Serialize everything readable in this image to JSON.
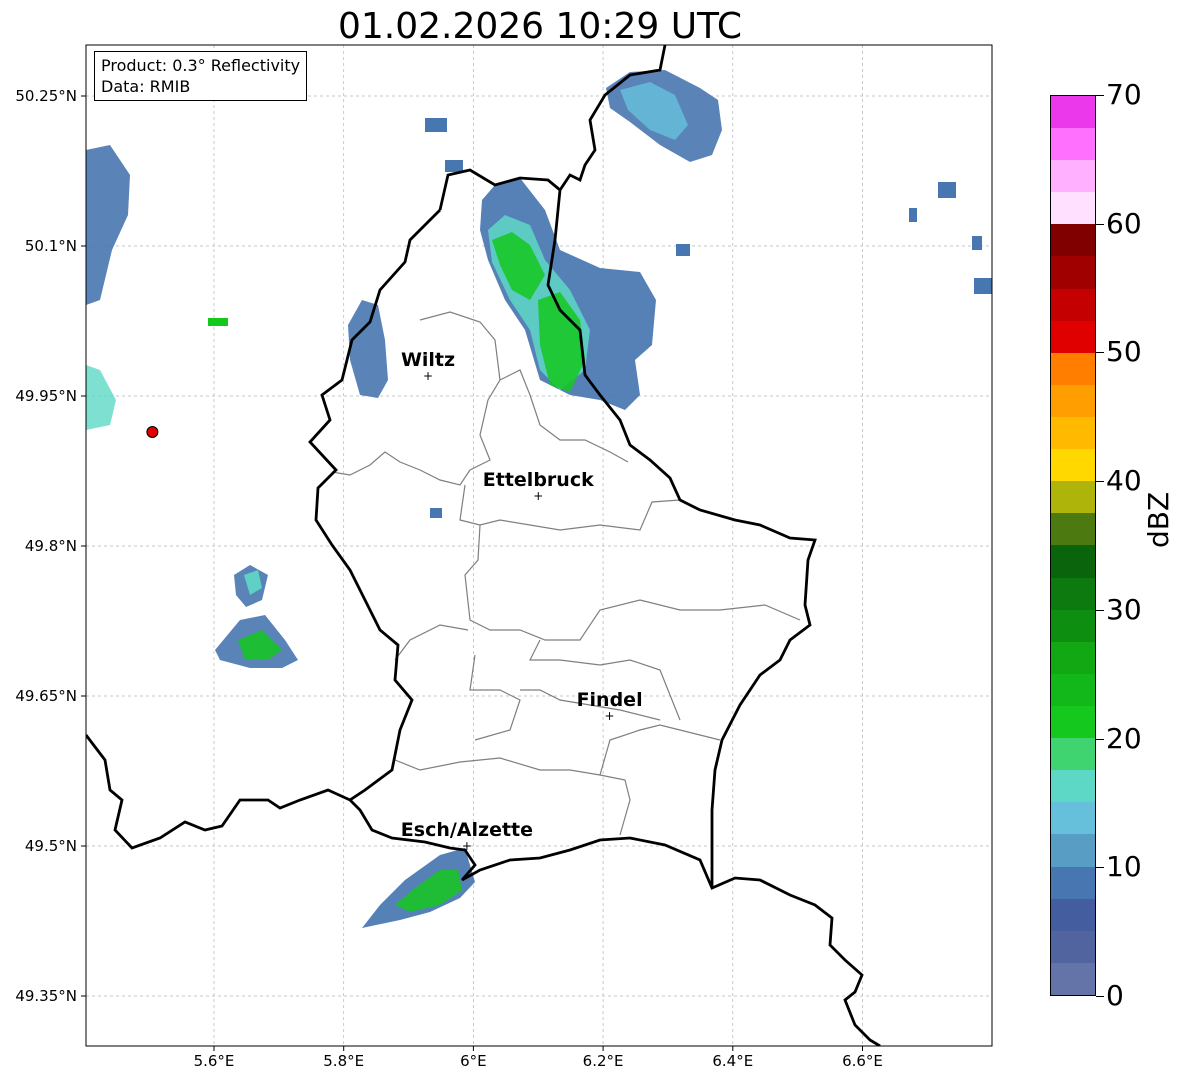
{
  "title": "01.02.2026 10:29 UTC",
  "info": {
    "product": "Product: 0.3° Reflectivity",
    "data": "Data: RMIB"
  },
  "lat_labels": [
    "50.25°N",
    "50.1°N",
    "49.95°N",
    "49.8°N",
    "49.65°N",
    "49.5°N",
    "49.35°N"
  ],
  "lon_labels": [
    "5.6°E",
    "5.8°E",
    "6°E",
    "6.2°E",
    "6.4°E",
    "6.6°E"
  ],
  "cities": [
    {
      "name": "Wiltz",
      "lon": 5.93,
      "lat": 49.97
    },
    {
      "name": "Ettelbruck",
      "lon": 6.1,
      "lat": 49.85
    },
    {
      "name": "Findel",
      "lon": 6.21,
      "lat": 49.63
    },
    {
      "name": "Esch/Alzette",
      "lon": 5.99,
      "lat": 49.5
    }
  ],
  "radar_site": {
    "lon": 5.505,
    "lat": 49.914,
    "color": "#e00000"
  },
  "colorbar": {
    "label": "dBZ",
    "ticks": [
      "0",
      "10",
      "20",
      "30",
      "40",
      "50",
      "60",
      "70"
    ],
    "colors": [
      "#6473a8",
      "#52649f",
      "#435d9f",
      "#4876b0",
      "#579dc4",
      "#66c0dc",
      "#5ed8c6",
      "#40d470",
      "#14c81e",
      "#12b81a",
      "#11a814",
      "#0e8e10",
      "#0c7a0e",
      "#0a640c",
      "#4c7a10",
      "#aeb40a",
      "#ffd800",
      "#ffba00",
      "#ff9e00",
      "#ff7e00",
      "#e00000",
      "#c40000",
      "#a00000",
      "#800000",
      "#ffe0ff",
      "#ffb0ff",
      "#ff70ff",
      "#ea38ea"
    ]
  }
}
